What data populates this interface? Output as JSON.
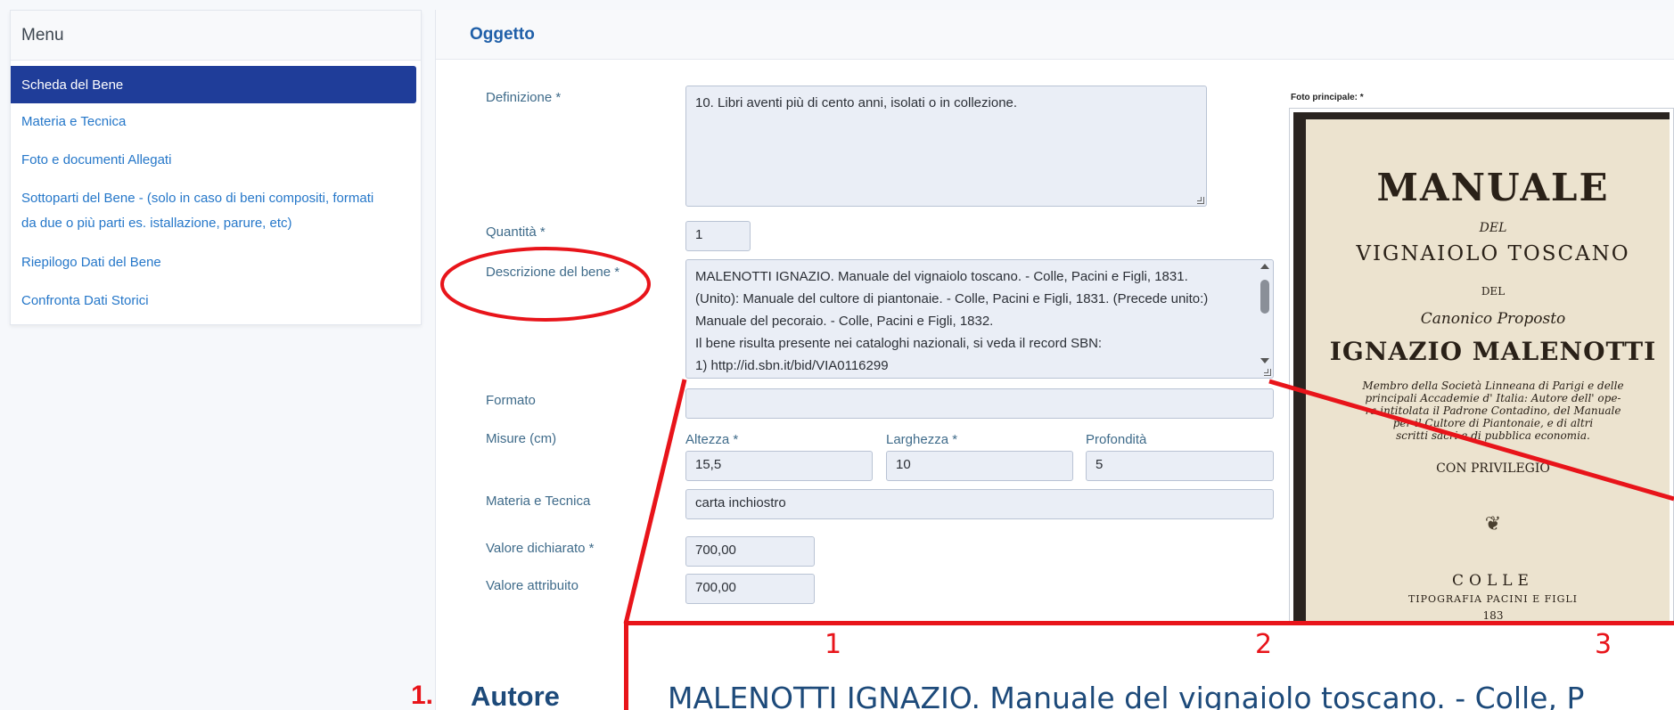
{
  "sidebar": {
    "title": "Menu",
    "items": [
      {
        "label": "Scheda del Bene",
        "active": true
      },
      {
        "label": "Materia e Tecnica"
      },
      {
        "label": "Foto e documenti Allegati"
      },
      {
        "label": "Sottoparti del Bene - (solo in caso di beni compositi, formati"
      },
      {
        "label": "da due o più parti es. istallazione, parure, etc)"
      },
      {
        "label": "Riepilogo Dati del Bene"
      },
      {
        "label": "Confronta Dati Storici"
      }
    ]
  },
  "main": {
    "title": "Oggetto",
    "definizione": {
      "label": "Definizione *",
      "value": "10. Libri aventi più di cento anni, isolati o in collezione."
    },
    "quantita": {
      "label": "Quantità *",
      "value": "1"
    },
    "descrizione": {
      "label": "Descrizione del bene *",
      "lines": [
        "MALENOTTI IGNAZIO. Manuale del vignaiolo toscano. - Colle, Pacini e Figli, 1831.",
        "(Unito): Manuale del cultore di piantonaie. - Colle, Pacini e Figli, 1831. (Precede unito:)",
        "Manuale del pecoraio. - Colle, Pacini e Figli, 1832.",
        "Il bene risulta presente nei cataloghi nazionali, si veda il record SBN:",
        "1) http://id.sbn.it/bid/VIA0116299"
      ]
    },
    "formato": {
      "label": "Formato",
      "value": ""
    },
    "misure": {
      "label": "Misure (cm)",
      "altezza": {
        "label": "Altezza *",
        "value": "15,5"
      },
      "larghezza": {
        "label": "Larghezza *",
        "value": "10"
      },
      "profondita": {
        "label": "Profondità",
        "value": "5"
      }
    },
    "materia": {
      "label": "Materia e Tecnica",
      "value": "carta inchiostro"
    },
    "valore_dichiarato": {
      "label": "Valore dichiarato *",
      "value": "700,00"
    },
    "valore_attribuito": {
      "label": "Valore attribuito",
      "value": "700,00"
    },
    "autore": {
      "number": "1.",
      "label": "Autore"
    }
  },
  "photo": {
    "label": "Foto principale: *",
    "page_text": {
      "l1": "MANUALE",
      "l2": "DEL",
      "l3": "VIGNAIOLO TOSCANO",
      "l4": "DEL",
      "l5": "Canonico Proposto",
      "l6": "IGNAZIO MALENOTTI",
      "l7": "Membro della Società Linneana di Parigi e delle",
      "l8": "principali Accademie d' Italia: Autore dell' ope-",
      "l9": "ra intitolata il Padrone Contadino, del Manuale",
      "l10": "per il Cultore di Piantonaie, e di altri",
      "l11": "scritti sacri e di pubblica economia.",
      "l12": "CON PRIVILEGIO",
      "l13": "COLLE",
      "l14": "TIPOGRAFIA PACINI E FIGLI",
      "l15": "183"
    }
  },
  "zoom": {
    "text": "MALENOTTI IGNAZIO. Manuale del vignaiolo toscano. - Colle, P",
    "markers": [
      "1",
      "2",
      "3"
    ]
  },
  "colors": {
    "accent": "#1f3d99",
    "link": "#2577c9",
    "annotation": "#e8141a"
  }
}
